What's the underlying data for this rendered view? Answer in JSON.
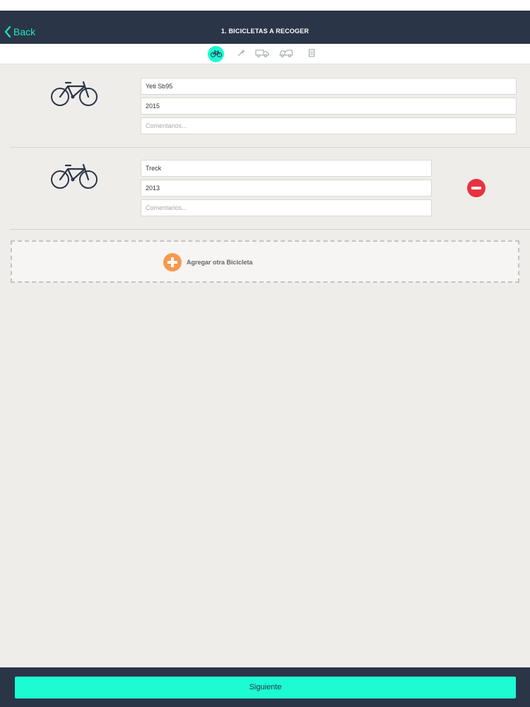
{
  "nav": {
    "back_label": "Back",
    "title": "1. BICICLETAS A RECOGER"
  },
  "steps": [
    {
      "icon": "bicycle-icon",
      "active": true
    },
    {
      "icon": "wrench-icon",
      "active": false
    },
    {
      "icon": "truck-icon",
      "active": false
    },
    {
      "icon": "delivery-truck-icon",
      "active": false
    },
    {
      "icon": "receipt-icon",
      "active": false
    }
  ],
  "bikes": [
    {
      "model": "Yeti Sb95",
      "year": "2015",
      "comments_placeholder": "Comentarios..."
    },
    {
      "model": "Treck",
      "year": "2013",
      "comments_placeholder": "Comentarios..."
    }
  ],
  "add_bike_label": "Agregar otra Bicicleta",
  "next_label": "Siguiente",
  "colors": {
    "navbar": "#2b3548",
    "accent": "#1dfbd3",
    "remove": "#e8323e",
    "add": "#f59a4f",
    "background": "#efedea"
  }
}
